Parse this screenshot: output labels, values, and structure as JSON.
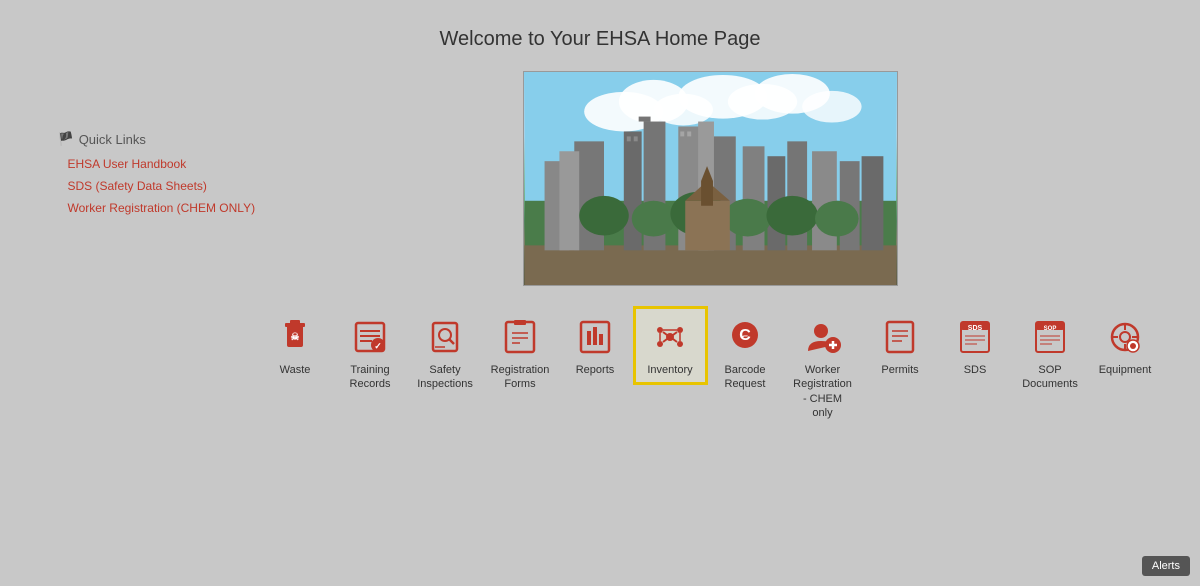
{
  "page": {
    "title": "Welcome to Your EHSA Home Page"
  },
  "quick_links": {
    "heading": "Quick Links",
    "items": [
      {
        "label": "EHSA User Handbook"
      },
      {
        "label": "SDS (Safety Data Sheets)"
      },
      {
        "label": "Worker Registration (CHEM ONLY)"
      }
    ]
  },
  "nav_items": [
    {
      "id": "waste",
      "label": "Waste",
      "highlighted": false
    },
    {
      "id": "training-records",
      "label": "Training Records",
      "highlighted": false
    },
    {
      "id": "safety-inspections",
      "label": "Safety Inspections",
      "highlighted": false
    },
    {
      "id": "registration-forms",
      "label": "Registration Forms",
      "highlighted": false
    },
    {
      "id": "reports",
      "label": "Reports",
      "highlighted": false
    },
    {
      "id": "inventory",
      "label": "Inventory",
      "highlighted": true
    },
    {
      "id": "barcode-request",
      "label": "Barcode Request",
      "highlighted": false
    },
    {
      "id": "worker-registration",
      "label": "Worker Registration - CHEM only",
      "highlighted": false
    },
    {
      "id": "permits",
      "label": "Permits",
      "highlighted": false
    },
    {
      "id": "sds",
      "label": "SDS",
      "highlighted": false
    },
    {
      "id": "sop-documents",
      "label": "SOP Documents",
      "highlighted": false
    },
    {
      "id": "equipment",
      "label": "Equipment",
      "highlighted": false
    }
  ],
  "alerts_badge": "Alerts"
}
